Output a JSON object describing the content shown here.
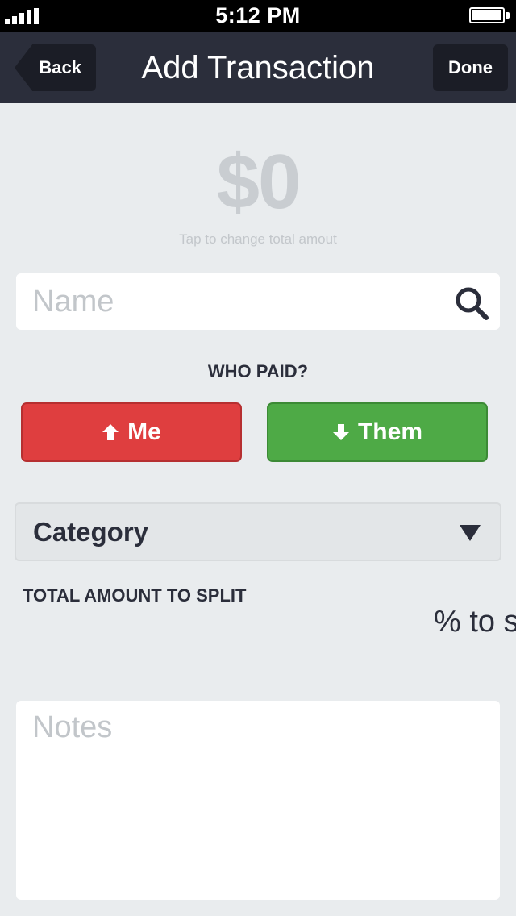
{
  "status_bar": {
    "time": "5:12 PM",
    "icons": [
      "signal-strength-icon",
      "battery-icon"
    ]
  },
  "nav": {
    "back_label": "Back",
    "title": "Add Transaction",
    "done_label": "Done"
  },
  "amount": {
    "value": "$0",
    "hint": "Tap to change total amout"
  },
  "name_field": {
    "placeholder": "Name",
    "value": "",
    "icon": "search-icon"
  },
  "who_paid": {
    "label": "WHO PAID?",
    "me_label": "Me",
    "me_icon": "arrow-up-icon",
    "them_label": "Them",
    "them_icon": "arrow-down-icon"
  },
  "category": {
    "label": "Category",
    "icon": "chevron-down-icon"
  },
  "split": {
    "label": "TOTAL AMOUNT TO SPLIT",
    "percent_text": "% to s"
  },
  "notes": {
    "placeholder": "Notes",
    "value": ""
  },
  "colors": {
    "nav_bg": "#2b2e3b",
    "nav_button_bg": "#1b1d26",
    "page_bg": "#e9ecee",
    "me_red": "#df3e3f",
    "them_green": "#4eaa46",
    "text_dark": "#2b2e3b",
    "placeholder_gray": "#c2c6ca"
  }
}
